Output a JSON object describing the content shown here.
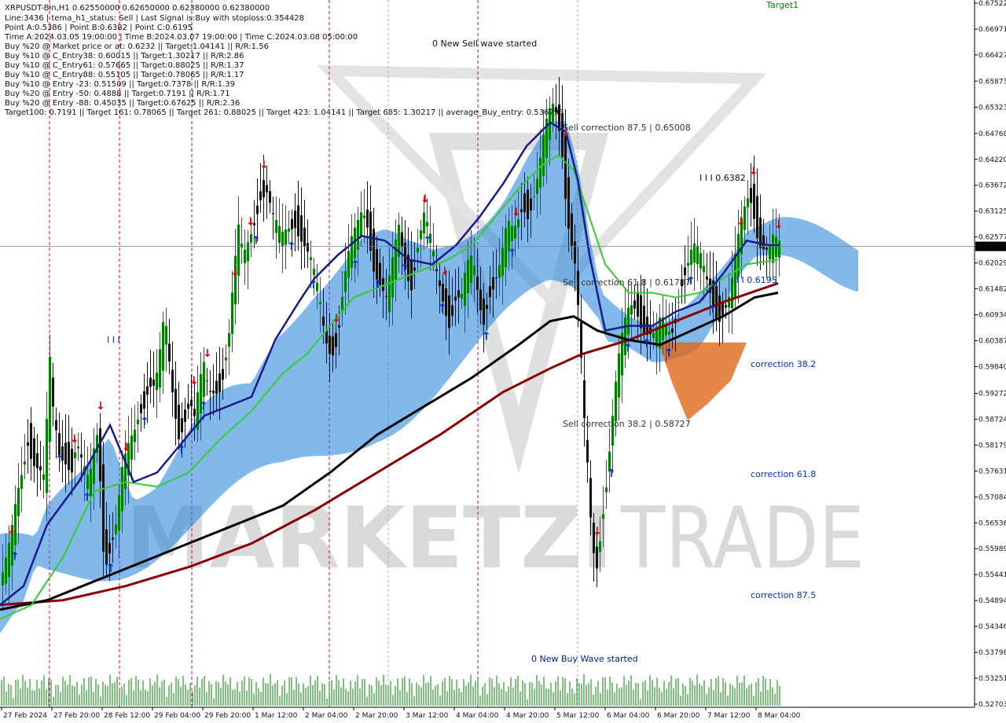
{
  "header": {
    "symbol_line": "XRPUSDT-Bin,H1   0.62550000 0.62650000 0.62380000 0.62380000",
    "lines": [
      "Line:3436 | tema_h1_status: Sell | Last Signal is:Buy with stoploss:0.354428",
      "Point A:0.5386 | Point B:0.6382 | Point C:0.6195",
      "Time A:2024.03.05 19:00:00 | Time B:2024.03.07 19:00:00 | Time C:2024.03.08 05:00:00",
      "Buy %20 @ Market price or at: 0.6232 || Target:1.04141 || R/R:1.56",
      "Buy %10 @ C_Entry38: 0.60015 || Target:1.30217 || R/R:2.86",
      "Buy %10 @ C_Entry61: 0.57665 || Target:0.88025 || R/R:1.37",
      "Buy %10 @ C_Entry88: 0.55105 || Target:0.78065 || R/R:1.17",
      "Buy %10 @ Entry -23: 0.51509 || Target:0.7378 || R/R:1.39",
      "Buy %20 @ Entry -50: 0.4888 || Target:0.7191 || R/R:1.71",
      "Buy %20 @ Entry -88: 0.45035 || Target:0.67625 || R/R:2.36",
      "Target100: 0.7191 || Target 161: 0.78065 || Target 261: 0.88025 || Target 423: 1.04141 || Target 685: 1.30217 || average_Buy_entry: 0.536793"
    ]
  },
  "watermark": {
    "left": "MARKETZI",
    "right": "TRADE"
  },
  "colors": {
    "bull": "#008000",
    "bear": "#111111",
    "ema_fast": "#1a1a8c",
    "ema_mid": "#33cc33",
    "ema_slow": "#000000",
    "ema_long": "#8b0000",
    "cloud_blue": "#1e7fd8",
    "cloud_orange": "#e0681a",
    "sell_arrow": "#e00000",
    "buy_arrow": "#0030d0",
    "price_line": "#708090",
    "magenta": "#cc0077",
    "dash_blue": "#8ab4d8"
  },
  "annotations": {
    "new_sell": "0 New Sell wave started",
    "new_buy": "0 New Buy Wave started",
    "target1": "Target1",
    "sell_corr_875": "Sell correction 87.5 | 0.65008",
    "sell_corr_618": "Sell correction 61.8 | 0.61787",
    "sell_corr_382": "Sell correction 38.2 | 0.58727",
    "point_b": "I I I 0.6382",
    "point_c": "I I I 0.6195",
    "corr_382": "correction 38.2",
    "corr_618": "correction 61.8",
    "corr_875": "correction 87.5",
    "wave_mark": "I I I"
  },
  "chart_data": {
    "type": "candlestick",
    "symbol": "XRPUSDT-Bin",
    "timeframe": "H1",
    "current_price": 0.6238,
    "current_price_label": "0.62380",
    "ylim": [
      0.52703,
      0.67522
    ],
    "y_ticks": [
      "0.67522",
      "0.66971",
      "0.66427",
      "0.65873",
      "0.65323",
      "0.64768",
      "0.64220",
      "0.63672",
      "0.63125",
      "0.62577",
      "0.62029",
      "0.61482",
      "0.60934",
      "0.60387",
      "0.59840",
      "0.59272",
      "0.58724",
      "0.58179",
      "0.57631",
      "0.57084",
      "0.56536",
      "0.55989",
      "0.55441",
      "0.54894",
      "0.54346",
      "0.53798",
      "0.53251",
      "0.52703"
    ],
    "x_labels": [
      "27 Feb 2024",
      "27 Feb 20:00",
      "28 Feb 12:00",
      "29 Feb 04:00",
      "29 Feb 20:00",
      "1 Mar 12:00",
      "2 Mar 04:00",
      "2 Mar 20:00",
      "3 Mar 12:00",
      "4 Mar 04:00",
      "4 Mar 20:00",
      "5 Mar 12:00",
      "6 Mar 04:00",
      "6 Mar 20:00",
      "7 Mar 12:00",
      "8 Mar 04:00"
    ],
    "price_path": [
      [
        0,
        0.552
      ],
      [
        8,
        0.555
      ],
      [
        16,
        0.56
      ],
      [
        24,
        0.57
      ],
      [
        32,
        0.578
      ],
      [
        38,
        0.584
      ],
      [
        44,
        0.58
      ],
      [
        52,
        0.577
      ],
      [
        58,
        0.574
      ],
      [
        62,
        0.585
      ],
      [
        66,
        0.598
      ],
      [
        70,
        0.588
      ],
      [
        78,
        0.58
      ],
      [
        86,
        0.58
      ],
      [
        94,
        0.578
      ],
      [
        100,
        0.583
      ],
      [
        108,
        0.576
      ],
      [
        116,
        0.572
      ],
      [
        122,
        0.58
      ],
      [
        128,
        0.586
      ],
      [
        132,
        0.565
      ],
      [
        136,
        0.558
      ],
      [
        140,
        0.56
      ],
      [
        150,
        0.565
      ],
      [
        158,
        0.575
      ],
      [
        166,
        0.58
      ],
      [
        174,
        0.585
      ],
      [
        180,
        0.59
      ],
      [
        186,
        0.592
      ],
      [
        192,
        0.596
      ],
      [
        200,
        0.594
      ],
      [
        206,
        0.6
      ],
      [
        212,
        0.608
      ],
      [
        218,
        0.598
      ],
      [
        224,
        0.59
      ],
      [
        230,
        0.585
      ],
      [
        236,
        0.588
      ],
      [
        244,
        0.592
      ],
      [
        250,
        0.587
      ],
      [
        256,
        0.593
      ],
      [
        262,
        0.597
      ],
      [
        268,
        0.592
      ],
      [
        276,
        0.594
      ],
      [
        284,
        0.596
      ],
      [
        294,
        0.606
      ],
      [
        300,
        0.617
      ],
      [
        306,
        0.626
      ],
      [
        312,
        0.62
      ],
      [
        318,
        0.624
      ],
      [
        326,
        0.63
      ],
      [
        334,
        0.636
      ],
      [
        342,
        0.636
      ],
      [
        350,
        0.629
      ],
      [
        356,
        0.626
      ],
      [
        362,
        0.625
      ],
      [
        370,
        0.628
      ],
      [
        378,
        0.63
      ],
      [
        388,
        0.626
      ],
      [
        398,
        0.62
      ],
      [
        408,
        0.612
      ],
      [
        416,
        0.604
      ],
      [
        424,
        0.602
      ],
      [
        432,
        0.606
      ],
      [
        440,
        0.617
      ],
      [
        448,
        0.623
      ],
      [
        456,
        0.626
      ],
      [
        464,
        0.631
      ],
      [
        470,
        0.629
      ],
      [
        478,
        0.621
      ],
      [
        486,
        0.617
      ],
      [
        494,
        0.612
      ],
      [
        502,
        0.619
      ],
      [
        510,
        0.627
      ],
      [
        518,
        0.62
      ],
      [
        526,
        0.617
      ],
      [
        534,
        0.625
      ],
      [
        542,
        0.63
      ],
      [
        550,
        0.624
      ],
      [
        558,
        0.617
      ],
      [
        566,
        0.613
      ],
      [
        574,
        0.609
      ],
      [
        582,
        0.614
      ],
      [
        590,
        0.613
      ],
      [
        596,
        0.618
      ],
      [
        604,
        0.62
      ],
      [
        612,
        0.612
      ],
      [
        618,
        0.609
      ],
      [
        624,
        0.615
      ],
      [
        632,
        0.617
      ],
      [
        640,
        0.62
      ],
      [
        648,
        0.627
      ],
      [
        656,
        0.626
      ],
      [
        662,
        0.63
      ],
      [
        668,
        0.634
      ],
      [
        674,
        0.632
      ],
      [
        680,
        0.634
      ],
      [
        688,
        0.639
      ],
      [
        694,
        0.645
      ],
      [
        700,
        0.65
      ],
      [
        706,
        0.653
      ],
      [
        712,
        0.652
      ],
      [
        718,
        0.645
      ],
      [
        724,
        0.632
      ],
      [
        730,
        0.625
      ],
      [
        734,
        0.62
      ],
      [
        738,
        0.61
      ],
      [
        742,
        0.598
      ],
      [
        746,
        0.585
      ],
      [
        750,
        0.576
      ],
      [
        756,
        0.56
      ],
      [
        762,
        0.557
      ],
      [
        768,
        0.567
      ],
      [
        774,
        0.575
      ],
      [
        780,
        0.585
      ],
      [
        788,
        0.597
      ],
      [
        796,
        0.605
      ],
      [
        804,
        0.611
      ],
      [
        812,
        0.612
      ],
      [
        820,
        0.608
      ],
      [
        828,
        0.606
      ],
      [
        836,
        0.604
      ],
      [
        844,
        0.607
      ],
      [
        852,
        0.605
      ],
      [
        860,
        0.607
      ],
      [
        868,
        0.617
      ],
      [
        876,
        0.62
      ],
      [
        884,
        0.623
      ],
      [
        892,
        0.621
      ],
      [
        900,
        0.617
      ],
      [
        908,
        0.614
      ],
      [
        916,
        0.61
      ],
      [
        924,
        0.611
      ],
      [
        932,
        0.613
      ],
      [
        940,
        0.622
      ],
      [
        948,
        0.63
      ],
      [
        956,
        0.636
      ],
      [
        962,
        0.632
      ],
      [
        968,
        0.626
      ],
      [
        974,
        0.624
      ],
      [
        980,
        0.622
      ],
      [
        986,
        0.624
      ],
      [
        992,
        0.623
      ]
    ],
    "ema_fast": [
      [
        0,
        0.548
      ],
      [
        30,
        0.552
      ],
      [
        60,
        0.565
      ],
      [
        100,
        0.574
      ],
      [
        140,
        0.586
      ],
      [
        170,
        0.574
      ],
      [
        200,
        0.576
      ],
      [
        230,
        0.582
      ],
      [
        260,
        0.588
      ],
      [
        290,
        0.59
      ],
      [
        320,
        0.592
      ],
      [
        350,
        0.604
      ],
      [
        380,
        0.612
      ],
      [
        400,
        0.617
      ],
      [
        430,
        0.622
      ],
      [
        460,
        0.626
      ],
      [
        490,
        0.625
      ],
      [
        520,
        0.621
      ],
      [
        550,
        0.62
      ],
      [
        580,
        0.624
      ],
      [
        610,
        0.63
      ],
      [
        640,
        0.637
      ],
      [
        670,
        0.645
      ],
      [
        700,
        0.65
      ],
      [
        720,
        0.648
      ],
      [
        735,
        0.638
      ],
      [
        750,
        0.622
      ],
      [
        770,
        0.606
      ],
      [
        800,
        0.607
      ],
      [
        830,
        0.607
      ],
      [
        860,
        0.61
      ],
      [
        890,
        0.612
      ],
      [
        920,
        0.618
      ],
      [
        950,
        0.625
      ],
      [
        980,
        0.624
      ],
      [
        992,
        0.624
      ]
    ],
    "ema_mid": [
      [
        0,
        0.545
      ],
      [
        40,
        0.548
      ],
      [
        80,
        0.558
      ],
      [
        120,
        0.572
      ],
      [
        160,
        0.574
      ],
      [
        200,
        0.573
      ],
      [
        240,
        0.576
      ],
      [
        280,
        0.583
      ],
      [
        320,
        0.589
      ],
      [
        360,
        0.597
      ],
      [
        390,
        0.601
      ],
      [
        420,
        0.607
      ],
      [
        450,
        0.613
      ],
      [
        480,
        0.615
      ],
      [
        510,
        0.617
      ],
      [
        540,
        0.619
      ],
      [
        570,
        0.621
      ],
      [
        600,
        0.624
      ],
      [
        630,
        0.63
      ],
      [
        660,
        0.636
      ],
      [
        690,
        0.641
      ],
      [
        710,
        0.643
      ],
      [
        730,
        0.64
      ],
      [
        750,
        0.63
      ],
      [
        770,
        0.62
      ],
      [
        800,
        0.614
      ],
      [
        830,
        0.614
      ],
      [
        860,
        0.613
      ],
      [
        890,
        0.614
      ],
      [
        920,
        0.617
      ],
      [
        950,
        0.62
      ],
      [
        990,
        0.621
      ]
    ],
    "ema_slow": [
      [
        0,
        0.547
      ],
      [
        60,
        0.549
      ],
      [
        120,
        0.553
      ],
      [
        180,
        0.557
      ],
      [
        240,
        0.561
      ],
      [
        300,
        0.565
      ],
      [
        360,
        0.569
      ],
      [
        420,
        0.576
      ],
      [
        480,
        0.584
      ],
      [
        540,
        0.59
      ],
      [
        600,
        0.596
      ],
      [
        660,
        0.603
      ],
      [
        700,
        0.608
      ],
      [
        730,
        0.609
      ],
      [
        760,
        0.606
      ],
      [
        800,
        0.604
      ],
      [
        840,
        0.603
      ],
      [
        880,
        0.606
      ],
      [
        920,
        0.609
      ],
      [
        960,
        0.613
      ],
      [
        990,
        0.614
      ]
    ],
    "ema_long": [
      [
        0,
        0.548
      ],
      [
        80,
        0.549
      ],
      [
        160,
        0.552
      ],
      [
        240,
        0.556
      ],
      [
        320,
        0.561
      ],
      [
        400,
        0.568
      ],
      [
        480,
        0.576
      ],
      [
        560,
        0.584
      ],
      [
        640,
        0.593
      ],
      [
        700,
        0.598
      ],
      [
        740,
        0.601
      ],
      [
        800,
        0.604
      ],
      [
        860,
        0.608
      ],
      [
        920,
        0.612
      ],
      [
        990,
        0.616
      ]
    ],
    "wave_points": {
      "A": 0.5386,
      "B": 0.6382,
      "C": 0.6195
    },
    "targets": {
      "Target100": 0.7191,
      "Target161": 0.78065,
      "Target261": 0.88025,
      "Target423": 1.04141,
      "Target685": 1.30217
    }
  }
}
